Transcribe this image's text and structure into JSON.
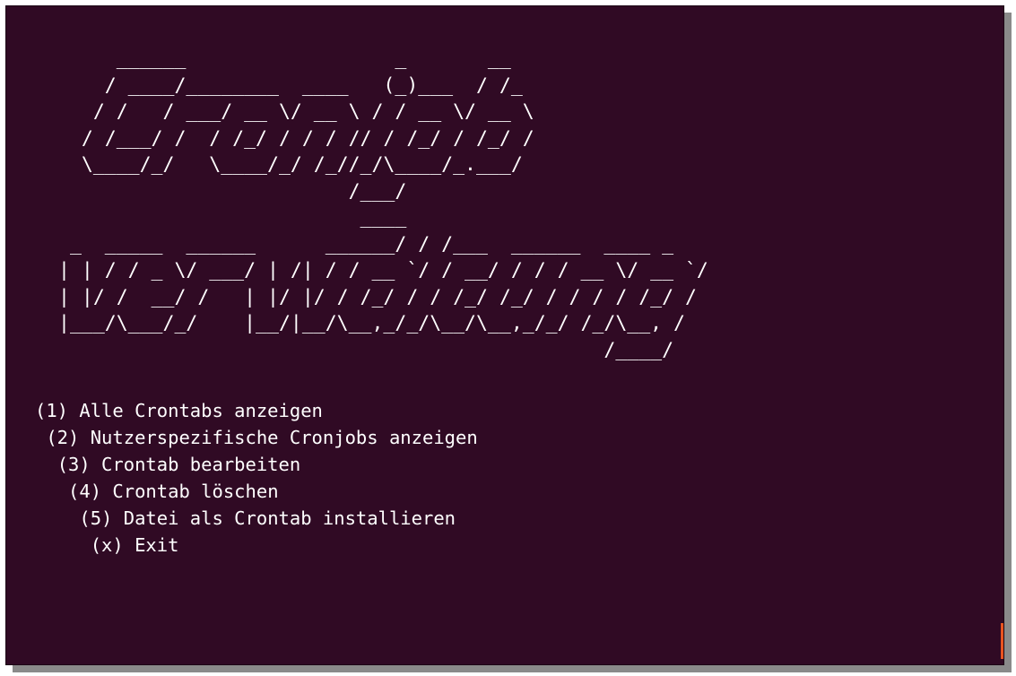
{
  "terminal": {
    "banner_art": "     ______                  _       __\n    / ____/________  ____   (_)___  / /_\n   / /   / ___/ __ \\/ __ \\ / / __ \\/ __ \\\n  / /___/ /  / /_/ / / / // / /_/ / /_/ /\n  \\____/_/   \\____/_/ /_//_/\\____/_.___/\n                         /___/\n                          ____\n _  _____  ______      ______/ / /___  ______  ____ _\n| | / / _ \\/ ___/ | /| / / __ `/ / __/ / / / __ \\/ __ `/\n| |/ /  __/ /   | |/ |/ / /_/ / / /_/ /_/ / / / / /_/ /\n|___/\\___/_/    |__/|__/\\__,_/_/\\__/\\__,_/_/ /_/\\__, /\n                                               /____/",
    "menu": [
      {
        "label": "(1) Alle Crontabs anzeigen",
        "indent": ""
      },
      {
        "label": "(2) Nutzerspezifische Cronjobs anzeigen",
        "indent": " "
      },
      {
        "label": "(3) Crontab bearbeiten",
        "indent": "  "
      },
      {
        "label": "(4) Crontab löschen",
        "indent": "   "
      },
      {
        "label": "(5) Datei als Crontab installieren",
        "indent": "    "
      },
      {
        "label": "(x) Exit",
        "indent": "     "
      }
    ],
    "colors": {
      "background": "#300a24",
      "foreground": "#ffffff",
      "cursor": "#e95420"
    }
  }
}
